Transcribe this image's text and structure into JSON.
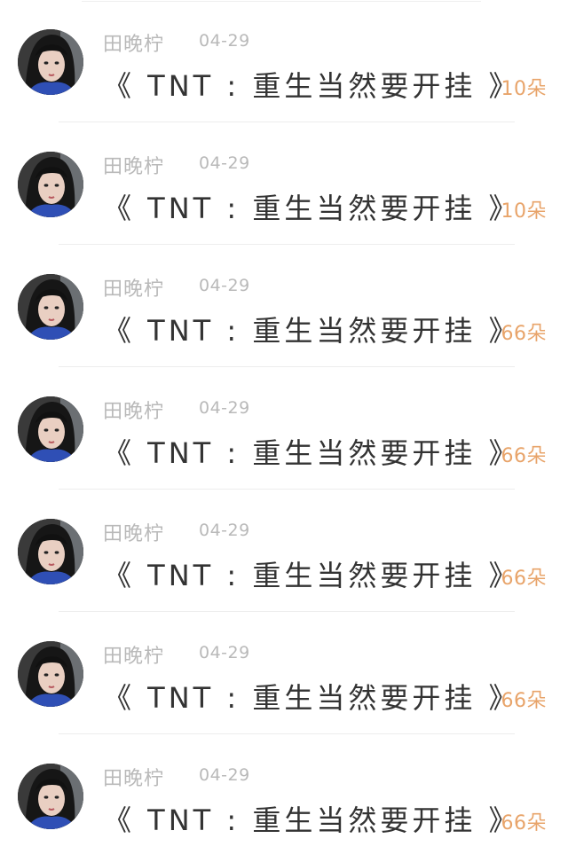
{
  "comments": [
    {
      "username": "田晚柠",
      "date": "04-29",
      "message": "《 TNT : 重生当然要开挂 》",
      "gift": "10朵"
    },
    {
      "username": "田晚柠",
      "date": "04-29",
      "message": "《 TNT : 重生当然要开挂 》",
      "gift": "10朵"
    },
    {
      "username": "田晚柠",
      "date": "04-29",
      "message": "《 TNT : 重生当然要开挂 》",
      "gift": "66朵"
    },
    {
      "username": "田晚柠",
      "date": "04-29",
      "message": "《 TNT : 重生当然要开挂 》",
      "gift": "66朵"
    },
    {
      "username": "田晚柠",
      "date": "04-29",
      "message": "《 TNT : 重生当然要开挂 》",
      "gift": "66朵"
    },
    {
      "username": "田晚柠",
      "date": "04-29",
      "message": "《 TNT : 重生当然要开挂 》",
      "gift": "66朵"
    },
    {
      "username": "田晚柠",
      "date": "04-29",
      "message": "《 TNT : 重生当然要开挂 》",
      "gift": "66朵"
    }
  ],
  "colors": {
    "username": "#b9b9b9",
    "date": "#b9b9b9",
    "message": "#333333",
    "gift": "#e8a46a",
    "divider": "#ededed"
  },
  "icons": {
    "avatar": "user-avatar-photo"
  }
}
